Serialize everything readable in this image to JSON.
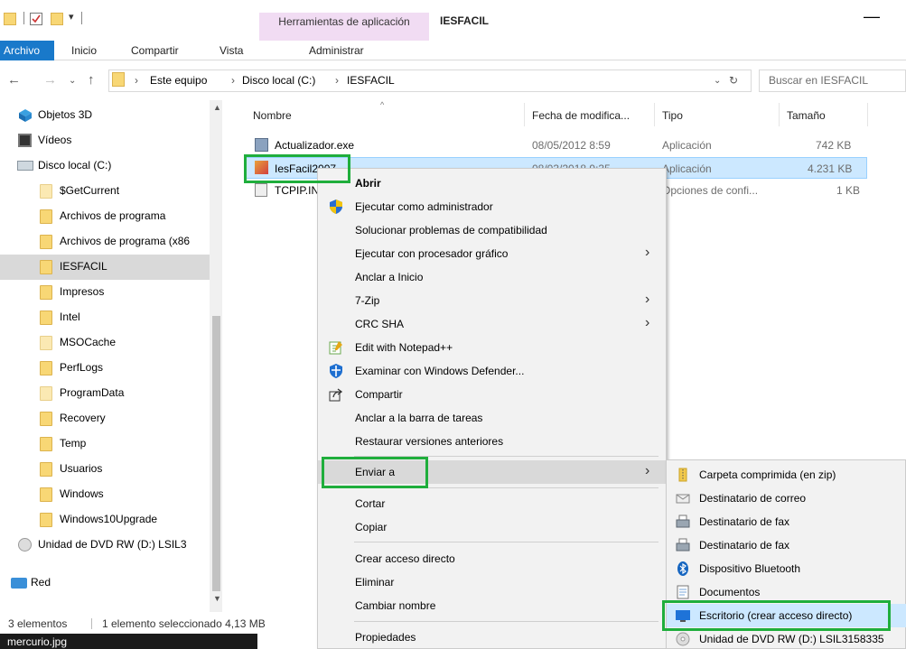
{
  "window": {
    "title": "IESFACIL",
    "contextual_tab_group": "Herramientas de aplicación",
    "minimize_symbol": "—"
  },
  "ribbon": {
    "tabs": [
      "Archivo",
      "Inicio",
      "Compartir",
      "Vista",
      "Administrar"
    ]
  },
  "address": {
    "crumbs": [
      "Este equipo",
      "Disco local (C:)",
      "IESFACIL"
    ],
    "search_placeholder": "Buscar en IESFACIL"
  },
  "nav": {
    "items": [
      {
        "label": "Objetos 3D",
        "icon": "3d-objects-icon"
      },
      {
        "label": "Vídeos",
        "icon": "videos-icon"
      },
      {
        "label": "Disco local (C:)",
        "icon": "drive-icon"
      },
      {
        "label": "$GetCurrent",
        "icon": "folder-icon"
      },
      {
        "label": "Archivos de programa",
        "icon": "folder-icon"
      },
      {
        "label": "Archivos de programa (x86",
        "icon": "folder-icon"
      },
      {
        "label": "IESFACIL",
        "icon": "folder-icon"
      },
      {
        "label": "Impresos",
        "icon": "folder-icon"
      },
      {
        "label": "Intel",
        "icon": "folder-icon"
      },
      {
        "label": "MSOCache",
        "icon": "folder-icon"
      },
      {
        "label": "PerfLogs",
        "icon": "folder-icon"
      },
      {
        "label": "ProgramData",
        "icon": "folder-icon"
      },
      {
        "label": "Recovery",
        "icon": "folder-icon"
      },
      {
        "label": "Temp",
        "icon": "folder-icon"
      },
      {
        "label": "Usuarios",
        "icon": "folder-icon"
      },
      {
        "label": "Windows",
        "icon": "folder-icon"
      },
      {
        "label": "Windows10Upgrade",
        "icon": "folder-icon"
      },
      {
        "label": "Unidad de DVD RW (D:) LSIL3",
        "icon": "dvd-icon"
      },
      {
        "label": "Red",
        "icon": "network-icon"
      }
    ]
  },
  "files": {
    "columns": [
      "Nombre",
      "Fecha de modifica...",
      "Tipo",
      "Tamaño"
    ],
    "rows": [
      {
        "name": "Actualizador.exe",
        "date": "08/05/2012 8:59",
        "type": "Aplicación",
        "size": "742 KB"
      },
      {
        "name": "IesFacil2007",
        "date": "08/03/2018 9:35",
        "type": "Aplicación",
        "size": "4.231 KB"
      },
      {
        "name": "TCPIP.INI",
        "date": "",
        "type": "Opciones de confi...",
        "size": "1 KB"
      }
    ]
  },
  "status": {
    "count": "3 elementos",
    "selection": "1 elemento seleccionado  4,13 MB"
  },
  "taskbar": {
    "item": "mercurio.jpg"
  },
  "context_menu": {
    "items": [
      {
        "label": "Abrir",
        "bold": true
      },
      {
        "label": "Ejecutar como administrador",
        "icon": "shield-icon"
      },
      {
        "label": "Solucionar problemas de compatibilidad"
      },
      {
        "label": "Ejecutar con procesador gráfico",
        "submenu": true
      },
      {
        "label": "Anclar a Inicio"
      },
      {
        "label": "7-Zip",
        "submenu": true
      },
      {
        "label": "CRC SHA",
        "submenu": true
      },
      {
        "label": "Edit with Notepad++",
        "icon": "notepad-icon"
      },
      {
        "label": "Examinar con Windows Defender...",
        "icon": "defender-icon"
      },
      {
        "label": "Compartir",
        "icon": "share-icon"
      },
      {
        "label": "Anclar a la barra de tareas"
      },
      {
        "label": "Restaurar versiones anteriores"
      },
      {
        "label": "Enviar a",
        "submenu": true
      },
      {
        "label": "Cortar"
      },
      {
        "label": "Copiar"
      },
      {
        "label": "Crear acceso directo"
      },
      {
        "label": "Eliminar"
      },
      {
        "label": "Cambiar nombre"
      },
      {
        "label": "Propiedades"
      }
    ],
    "arrow_symbol": "›"
  },
  "send_to_menu": {
    "items": [
      {
        "label": "Carpeta comprimida (en zip)",
        "icon": "zip-folder-icon"
      },
      {
        "label": "Destinatario de correo",
        "icon": "mail-icon"
      },
      {
        "label": "Destinatario de fax",
        "icon": "fax-icon"
      },
      {
        "label": "Destinatario de fax",
        "icon": "fax-icon"
      },
      {
        "label": "Dispositivo Bluetooth",
        "icon": "bluetooth-icon"
      },
      {
        "label": "Documentos",
        "icon": "documents-icon"
      },
      {
        "label": "Escritorio (crear acceso directo)",
        "icon": "desktop-icon"
      },
      {
        "label": "Unidad de DVD RW (D:) LSIL3158335",
        "icon": "dvd-icon"
      }
    ]
  },
  "colors": {
    "accent": "#1979ca",
    "highlight_box": "#1fae3c",
    "selection": "#cce8ff",
    "contextual_tab": "#f1dcf3"
  }
}
